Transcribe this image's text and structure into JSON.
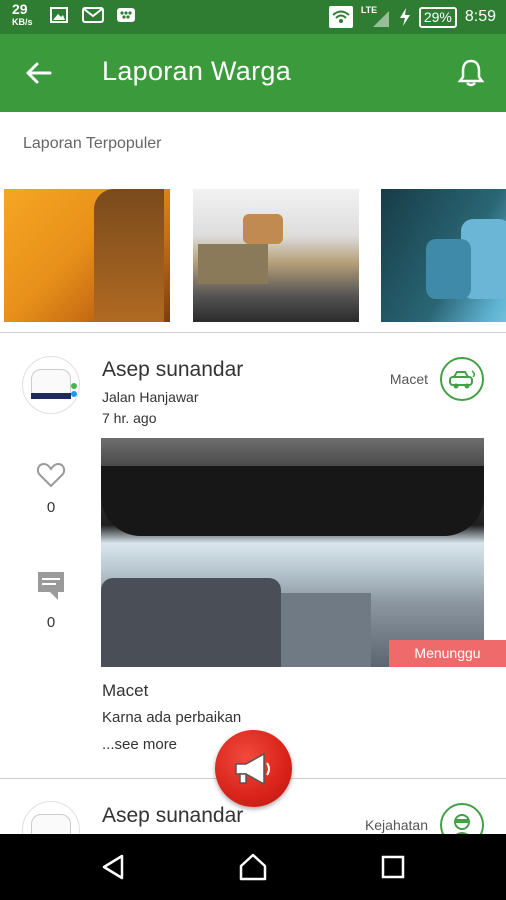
{
  "status_bar": {
    "net_speed": "29",
    "net_unit": "KB/s",
    "network": "LTE",
    "battery": "29%",
    "time": "8:59"
  },
  "app_bar": {
    "title": "Laporan Warga",
    "back_icon": "arrow-back-icon",
    "notification_icon": "bell-icon"
  },
  "popular": {
    "label": "Laporan Terpopuler",
    "thumbnails": [
      "orange-garment-photo",
      "desk-cables-photo",
      "blue-bags-photo"
    ]
  },
  "reports": [
    {
      "user": "Asep sunandar",
      "location": "Jalan Hanjawar",
      "time_ago": "7 hr. ago",
      "category": "Macet",
      "category_icon": "traffic-jam-icon",
      "likes": "0",
      "comments": "0",
      "status": "Menunggu",
      "title": "Macet",
      "description": "Karna ada perbaikan",
      "see_more": "...see more"
    },
    {
      "user": "Asep sunandar",
      "category": "Kejahatan",
      "category_icon": "crime-thief-icon"
    }
  ],
  "fab": {
    "icon": "megaphone-icon"
  },
  "colors": {
    "app_bar": "#3a9a3c",
    "status_bar": "#2e7d32",
    "badge": "#ef6b6b",
    "fab": "#d8231a"
  }
}
